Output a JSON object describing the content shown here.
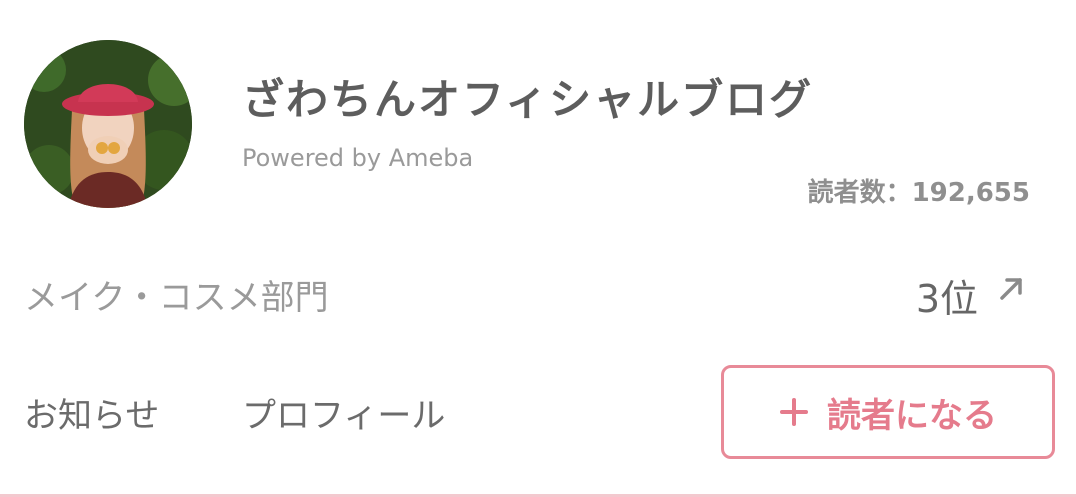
{
  "header": {
    "blog_title": "ざわちんオフィシャルブログ",
    "powered_by": "Powered by Ameba",
    "readers_text": "読者数：192,655"
  },
  "ranking": {
    "category": "メイク・コスメ部門",
    "rank": "3位",
    "trend_icon": "arrow-up-right-icon"
  },
  "nav": {
    "news_label": "お知らせ",
    "profile_label": "プロフィール"
  },
  "follow_button": {
    "label": "読者になる",
    "icon": "plus-icon"
  },
  "colors": {
    "accent": "#e57b8c",
    "title": "#5d5d5d",
    "muted": "#9a9a9a"
  }
}
